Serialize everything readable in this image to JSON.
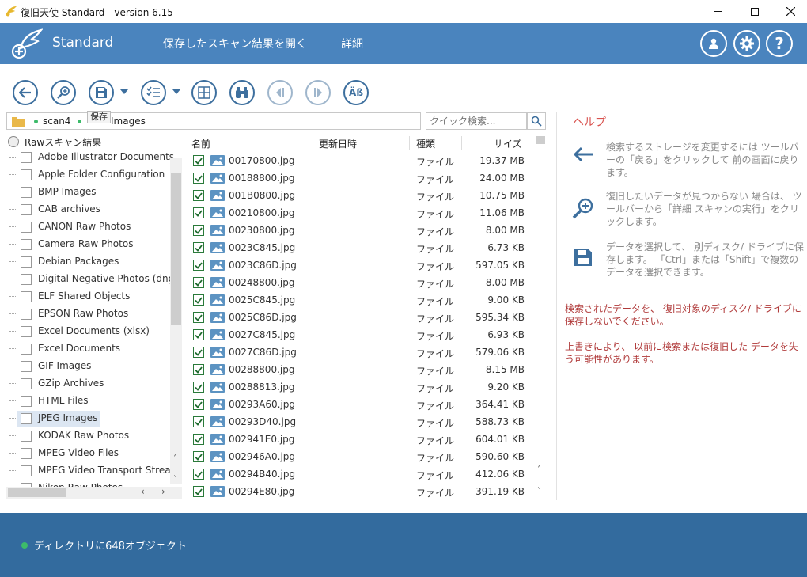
{
  "window": {
    "title": "復旧天使 Standard - version 6.15",
    "minimize_icon": "minimize-icon",
    "maximize_icon": "maximize-icon",
    "close_icon": "close-icon"
  },
  "header": {
    "brand": "Standard",
    "menu": [
      "保存したスキャン結果を開く",
      "詳細"
    ],
    "buttons": [
      "user-icon",
      "gear-icon",
      "help-icon"
    ],
    "color": "#4a84be"
  },
  "toolbar": {
    "tooltip": "保存",
    "buttons": [
      "back-icon",
      "search-zoom-icon",
      "save-icon",
      "checklist-icon",
      "grid-icon",
      "binoculars-icon",
      "prev-icon",
      "next-icon",
      "case-icon"
    ],
    "case_label": "Äß"
  },
  "path": {
    "segments": [
      "scan4",
      "Images"
    ],
    "search_placeholder": "クイック検索..."
  },
  "tree": {
    "root": "Rawスキャン結果",
    "items": [
      "Adobe Illustrator Documents",
      "Apple Folder Configuration",
      "BMP Images",
      "CAB archives",
      "CANON Raw Photos",
      "Camera Raw Photos",
      "Debian Packages",
      "Digital Negative Photos (dng)",
      "ELF Shared Objects",
      "EPSON Raw Photos",
      "Excel Documents (xlsx)",
      "Excel Documents",
      "GIF Images",
      "GZip Archives",
      "HTML Files",
      "JPEG Images",
      "KODAK Raw Photos",
      "MPEG Video Files",
      "MPEG Video Transport Stream",
      "Nikon Raw Photos"
    ],
    "selected": "JPEG Images"
  },
  "list": {
    "columns": [
      "名前",
      "更新日時",
      "種類",
      "サイズ"
    ],
    "rows": [
      {
        "name": "00170800.jpg",
        "type": "ファイル",
        "size": "19.37 MB"
      },
      {
        "name": "00188800.jpg",
        "type": "ファイル",
        "size": "24.00 MB"
      },
      {
        "name": "001B0800.jpg",
        "type": "ファイル",
        "size": "10.75 MB"
      },
      {
        "name": "00210800.jpg",
        "type": "ファイル",
        "size": "11.06 MB"
      },
      {
        "name": "00230800.jpg",
        "type": "ファイル",
        "size": "8.00 MB"
      },
      {
        "name": "0023C845.jpg",
        "type": "ファイル",
        "size": "6.73 KB"
      },
      {
        "name": "0023C86D.jpg",
        "type": "ファイル",
        "size": "597.05 KB"
      },
      {
        "name": "00248800.jpg",
        "type": "ファイル",
        "size": "8.00 MB"
      },
      {
        "name": "0025C845.jpg",
        "type": "ファイル",
        "size": "9.00 KB"
      },
      {
        "name": "0025C86D.jpg",
        "type": "ファイル",
        "size": "595.34 KB"
      },
      {
        "name": "0027C845.jpg",
        "type": "ファイル",
        "size": "6.93 KB"
      },
      {
        "name": "0027C86D.jpg",
        "type": "ファイル",
        "size": "579.06 KB"
      },
      {
        "name": "00288800.jpg",
        "type": "ファイル",
        "size": "8.15 MB"
      },
      {
        "name": "00288813.jpg",
        "type": "ファイル",
        "size": "9.20 KB"
      },
      {
        "name": "00293A60.jpg",
        "type": "ファイル",
        "size": "364.41 KB"
      },
      {
        "name": "00293D40.jpg",
        "type": "ファイル",
        "size": "588.73 KB"
      },
      {
        "name": "002941E0.jpg",
        "type": "ファイル",
        "size": "604.01 KB"
      },
      {
        "name": "002946A0.jpg",
        "type": "ファイル",
        "size": "590.60 KB"
      },
      {
        "name": "00294B40.jpg",
        "type": "ファイル",
        "size": "412.06 KB"
      },
      {
        "name": "00294E80.jpg",
        "type": "ファイル",
        "size": "391.19 KB"
      }
    ]
  },
  "help": {
    "title": "ヘルプ",
    "items": [
      {
        "icon": "back-arrow-icon",
        "text": "検索するストレージを変更するには ツールバーの「戻る」をクリックして 前の画面に戻ります。"
      },
      {
        "icon": "search-zoom-icon",
        "text": "復旧したいデータが見つからない 場合は、 ツールバーから「詳細 スキャンの実行」をクリックします。"
      },
      {
        "icon": "save-icon",
        "text": "データを選択して、 別ディスク/ ドライブに保存します。 「Ctrl」または「Shift」で複数の データを選択できます。"
      }
    ],
    "warnings": [
      "検索されたデータを、 復旧対象のディスク/ ドライブに保存しないでください。",
      "上書きにより、 以前に検索または復旧した データを失う可能性があります。"
    ]
  },
  "status": {
    "text": "ディレクトリに648オブジェクト",
    "color": "#336b9e"
  }
}
